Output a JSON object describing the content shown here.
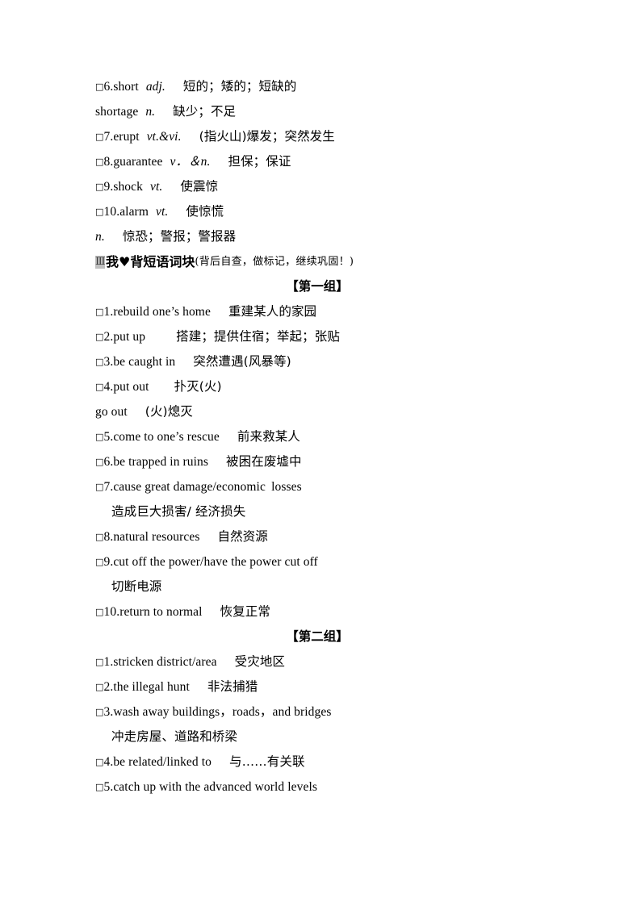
{
  "document": {
    "type": "vocabulary-study-sheet",
    "language": "zh-CN/en"
  },
  "word_list": {
    "entries": [
      {
        "checkbox": "□",
        "number": "6.",
        "word": "short",
        "pos": "adj.",
        "meaning": "短的；矮的；短缺的"
      },
      {
        "checkbox": "",
        "number": "",
        "word": "shortage",
        "pos": "n.",
        "meaning": "缺少；不足"
      },
      {
        "checkbox": "□",
        "number": "7.",
        "word": "erupt",
        "pos": "vt.&vi.",
        "meaning": "(指火山)爆发；突然发生"
      },
      {
        "checkbox": "□",
        "number": "8.",
        "word": "guarantee",
        "pos": "v．＆n.",
        "meaning": "担保；保证"
      },
      {
        "checkbox": "□",
        "number": "9.",
        "word": "shock",
        "pos": "vt.",
        "meaning": "使震惊"
      },
      {
        "checkbox": "□",
        "number": "10.",
        "word": "alarm",
        "pos": "vt.",
        "meaning": "使惊慌"
      },
      {
        "checkbox": "",
        "number": "",
        "word": "",
        "pos": "n.",
        "meaning": "惊恐；警报；警报器"
      }
    ]
  },
  "section": {
    "icon_label": "Ⅲ",
    "title": "我♥背短语词块",
    "note": "(背后自查，做标记，继续巩固！)"
  },
  "groups": [
    {
      "title": "【第一组】",
      "items": [
        {
          "checkbox": "□",
          "number": "1.",
          "phrase": "rebuild one’s home",
          "meaning": "重建某人的家园",
          "continuation": null
        },
        {
          "checkbox": "□",
          "number": "2.",
          "phrase": "put up",
          "meaning": "搭建；提供住宿；举起；张贴",
          "continuation": null
        },
        {
          "checkbox": "□",
          "number": "3.",
          "phrase": "be caught in",
          "meaning": "突然遭遇(风暴等)",
          "continuation": null
        },
        {
          "checkbox": "□",
          "number": "4.",
          "phrase": "put out",
          "meaning": "扑灭(火)",
          "continuation": null
        },
        {
          "checkbox": "",
          "number": "",
          "phrase": "go out",
          "meaning": "(火)熄灭",
          "continuation": null
        },
        {
          "checkbox": "□",
          "number": "5.",
          "phrase": "come to one’s rescue",
          "meaning": "前来救某人",
          "continuation": null
        },
        {
          "checkbox": "□",
          "number": "6.",
          "phrase": "be trapped in ruins",
          "meaning": "被困在废墟中",
          "continuation": null
        },
        {
          "checkbox": "□",
          "number": "7.",
          "phrase": "cause great damage/economic  losses",
          "meaning": "",
          "continuation": "造成巨大损害/ 经济损失"
        },
        {
          "checkbox": "□",
          "number": "8.",
          "phrase": "natural resources",
          "meaning": "自然资源",
          "continuation": null
        },
        {
          "checkbox": "□",
          "number": "9.",
          "phrase": "cut off the power/have the power cut off",
          "meaning": "",
          "continuation": "切断电源"
        },
        {
          "checkbox": "□",
          "number": "10.",
          "phrase": "return to normal",
          "meaning": "恢复正常",
          "continuation": null
        }
      ]
    },
    {
      "title": "【第二组】",
      "items": [
        {
          "checkbox": "□",
          "number": "1.",
          "phrase": "stricken district/area",
          "meaning": "受灾地区",
          "continuation": null
        },
        {
          "checkbox": "□",
          "number": "2.",
          "phrase": "the illegal hunt",
          "meaning": "非法捕猎",
          "continuation": null
        },
        {
          "checkbox": "□",
          "number": "3.",
          "phrase": "wash away buildings，roads，and bridges",
          "meaning": "",
          "continuation": "冲走房屋、道路和桥梁"
        },
        {
          "checkbox": "□",
          "number": "4.",
          "phrase": "be related/linked to",
          "meaning": "与……有关联",
          "continuation": null
        },
        {
          "checkbox": "□",
          "number": "5.",
          "phrase": "catch up with the advanced world levels",
          "meaning": "",
          "continuation": null
        }
      ]
    }
  ]
}
